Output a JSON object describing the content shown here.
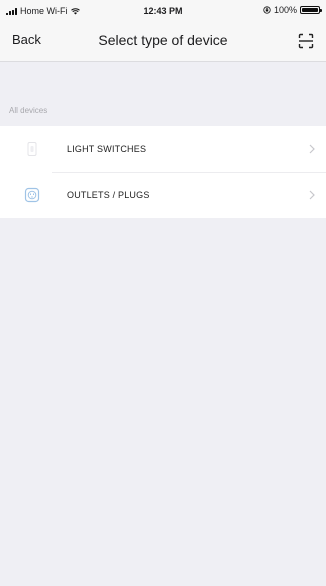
{
  "status_bar": {
    "carrier": "Home Wi-Fi",
    "time": "12:43 PM",
    "battery": "100%",
    "battery_level": 1.0
  },
  "nav": {
    "back_label": "Back",
    "title": "Select type of device",
    "scan_icon": "scan-icon"
  },
  "section": {
    "label": "All devices"
  },
  "devices": [
    {
      "label": "LIGHT SWITCHES",
      "icon": "light-switch-icon"
    },
    {
      "label": "OUTLETS / PLUGS",
      "icon": "outlet-icon"
    }
  ],
  "colors": {
    "background": "#efeff4",
    "bar": "#f7f7f7",
    "accent_icon": "#9fc3e6"
  }
}
